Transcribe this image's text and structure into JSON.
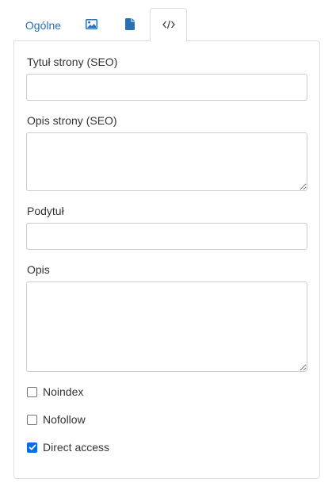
{
  "tabs": [
    {
      "label": "Ogólne",
      "active": false
    },
    {
      "icon": "image-icon",
      "active": false
    },
    {
      "icon": "file-icon",
      "active": false
    },
    {
      "icon": "code-icon",
      "active": true
    }
  ],
  "fields": {
    "seo_title": {
      "label": "Tytuł strony (SEO)",
      "value": ""
    },
    "seo_description": {
      "label": "Opis strony (SEO)",
      "value": ""
    },
    "subtitle": {
      "label": "Podytuł",
      "value": ""
    },
    "description": {
      "label": "Opis",
      "value": ""
    }
  },
  "checkboxes": [
    {
      "label": "Noindex",
      "checked": false
    },
    {
      "label": "Nofollow",
      "checked": false
    },
    {
      "label": "Direct access",
      "checked": true
    }
  ],
  "colors": {
    "link": "#2a6fb0",
    "checked": "#0b6ee0",
    "border": "#dddddd"
  }
}
